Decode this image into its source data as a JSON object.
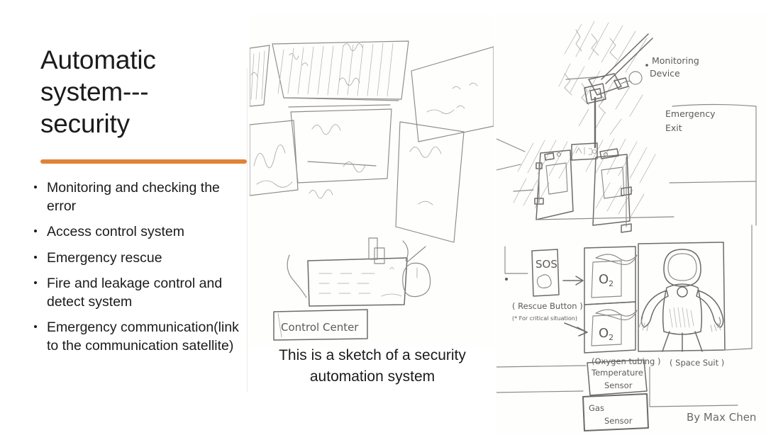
{
  "slide": {
    "title": "Automatic system--- security",
    "title_lines": "Automatic\nsystem---\nsecurity",
    "accent_color": "#e08238",
    "background_color": "#ffffff",
    "text_color": "#1b1b1b"
  },
  "bullets": [
    {
      "text": "Monitoring and checking the error"
    },
    {
      "text": "Access control system"
    },
    {
      "text": "Emergency rescue"
    },
    {
      "text": "Fire and leakage control and detect system"
    },
    {
      "text": "Emergency communication(link to the communication satellite)"
    }
  ],
  "caption": {
    "text": "This is a sketch of a security automation system"
  },
  "sketch_left": {
    "name": "control-center-sketch",
    "label_control_center": "Control  Center"
  },
  "sketch_right": {
    "name": "security-automation-sketch",
    "labels": {
      "monitoring_device": "Monitoring\nDevice",
      "monitoring_device_l1": "Monitoring",
      "monitoring_device_l2": "Device",
      "emergency_exit_l1": "Emergency",
      "emergency_exit_l2": "Exit",
      "sos": "SOS",
      "rescue_button": "( Rescue Button )",
      "critical_situation": "(* For  critical  situation)",
      "oxygen_1": "O",
      "oxygen_1_sub": "2",
      "oxygen_2": "O",
      "oxygen_2_sub": "2",
      "oxygen_tubing": "(Oxygen tubing )",
      "space_suit": "( Space Suit )",
      "temperature_sensor_l1": "Temperature",
      "temperature_sensor_l2": "Sensor",
      "gas_sensor_l1": "Gas",
      "gas_sensor_l2": "Sensor",
      "signature": "By Max Chen"
    }
  }
}
